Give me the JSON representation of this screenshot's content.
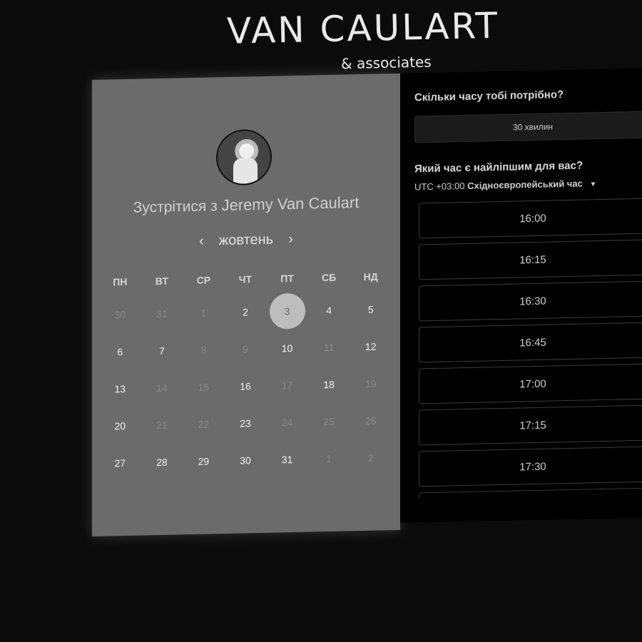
{
  "brand": {
    "title": "VAN CAULART",
    "subtitle": "& associates"
  },
  "calendar": {
    "meet_prefix": "Зустрітися з",
    "host_name": "Jeremy Van Caulart",
    "month": "жовтень",
    "prev": "‹",
    "next": "›",
    "weekdays": [
      "ПН",
      "ВТ",
      "СР",
      "ЧТ",
      "ПТ",
      "СБ",
      "НД"
    ],
    "days": [
      {
        "d": "30",
        "state": "muted"
      },
      {
        "d": "31",
        "state": "muted"
      },
      {
        "d": "1",
        "state": "muted"
      },
      {
        "d": "2",
        "state": "active"
      },
      {
        "d": "3",
        "state": "selected"
      },
      {
        "d": "4",
        "state": "active"
      },
      {
        "d": "5",
        "state": "active"
      },
      {
        "d": "6",
        "state": "active"
      },
      {
        "d": "7",
        "state": "active"
      },
      {
        "d": "8",
        "state": "muted"
      },
      {
        "d": "9",
        "state": "muted"
      },
      {
        "d": "10",
        "state": "active"
      },
      {
        "d": "11",
        "state": "muted"
      },
      {
        "d": "12",
        "state": "active"
      },
      {
        "d": "13",
        "state": "active"
      },
      {
        "d": "14",
        "state": "muted"
      },
      {
        "d": "15",
        "state": "muted"
      },
      {
        "d": "16",
        "state": "active"
      },
      {
        "d": "17",
        "state": "muted"
      },
      {
        "d": "18",
        "state": "active"
      },
      {
        "d": "19",
        "state": "muted"
      },
      {
        "d": "20",
        "state": "active"
      },
      {
        "d": "21",
        "state": "muted"
      },
      {
        "d": "22",
        "state": "muted"
      },
      {
        "d": "23",
        "state": "active"
      },
      {
        "d": "24",
        "state": "muted"
      },
      {
        "d": "25",
        "state": "muted"
      },
      {
        "d": "26",
        "state": "muted"
      },
      {
        "d": "27",
        "state": "active"
      },
      {
        "d": "28",
        "state": "active"
      },
      {
        "d": "29",
        "state": "active"
      },
      {
        "d": "30",
        "state": "active"
      },
      {
        "d": "31",
        "state": "active"
      },
      {
        "d": "1",
        "state": "muted"
      },
      {
        "d": "2",
        "state": "muted"
      }
    ]
  },
  "booking": {
    "duration_question": "Скільки часу тобі потрібно?",
    "duration_value": "30 хвилин",
    "time_question": "Який час є найліпшим для вас?",
    "timezone_offset": "UTC +03:00",
    "timezone_name": "Східноєвропейський час",
    "dropdown_icon": "caret-down-icon",
    "slots": [
      "16:00",
      "16:15",
      "16:30",
      "16:45",
      "17:00",
      "17:15",
      "17:30"
    ]
  },
  "colors": {
    "background": "#0b0b0b",
    "left_panel": "#6b6b6b",
    "right_panel": "#000000",
    "selected_day": "#bdbdbd"
  }
}
